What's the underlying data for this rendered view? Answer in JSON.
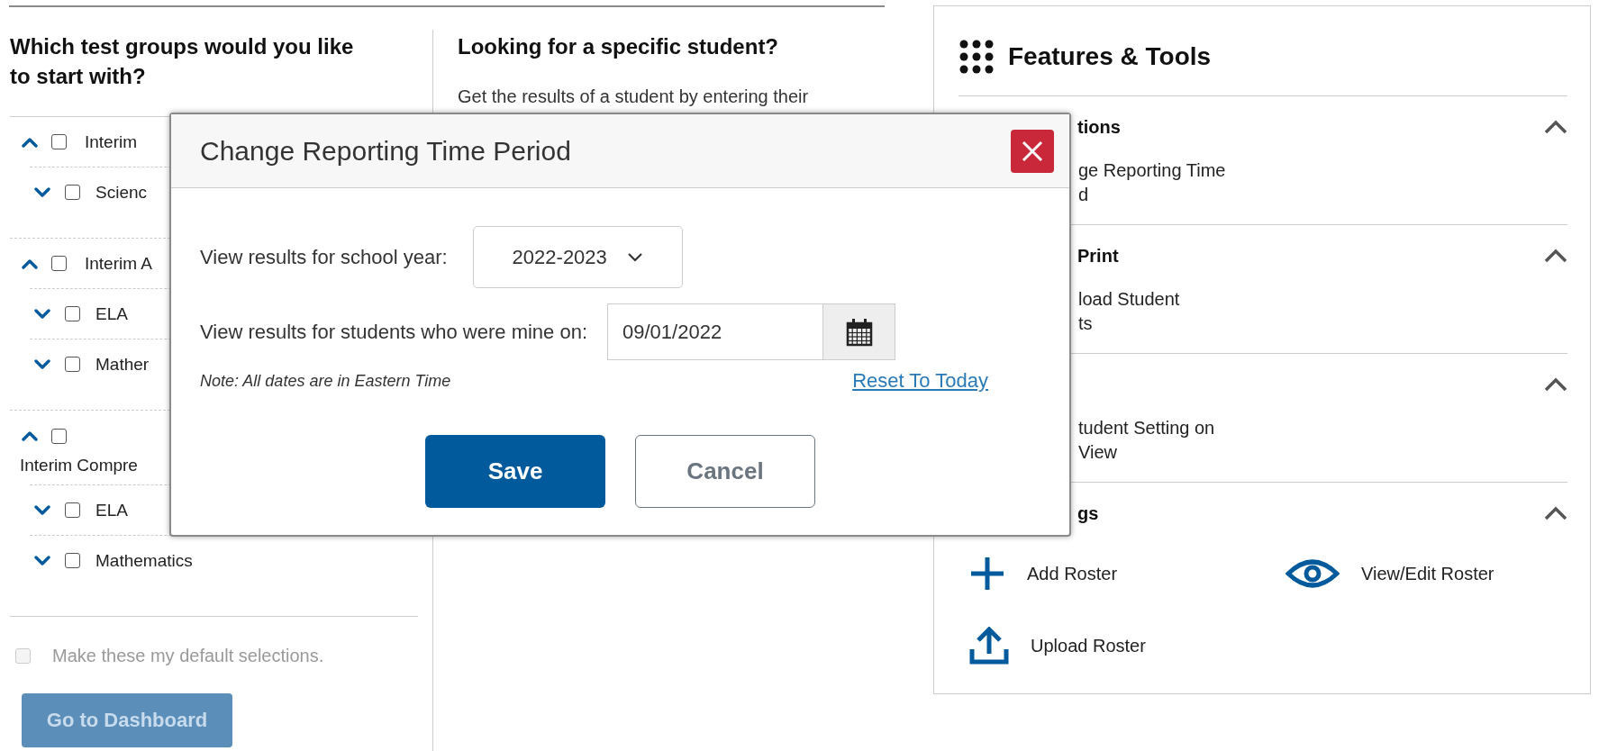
{
  "left": {
    "heading": "Which test groups would you like to start with?",
    "groups": [
      {
        "label": "Interim",
        "kind": "inline",
        "expanded": true,
        "checked": false,
        "children": [
          {
            "label": "Scienc",
            "expanded": false,
            "checked": false
          }
        ]
      },
      {
        "label": "Interim A",
        "kind": "inline",
        "expanded": true,
        "checked": false,
        "children": [
          {
            "label": "ELA",
            "expanded": false,
            "checked": false
          },
          {
            "label": "Mather",
            "expanded": false,
            "checked": false
          }
        ]
      },
      {
        "label": "Interim Compre",
        "kind": "stacked",
        "expanded": true,
        "checked": false,
        "children": [
          {
            "label": "ELA",
            "expanded": false,
            "checked": false
          },
          {
            "label": "Mathematics",
            "expanded": false,
            "checked": false
          }
        ]
      }
    ],
    "default_selection": {
      "label": "Make these my default selections.",
      "checked": false,
      "disabled": true
    },
    "dashboard_button": {
      "label": "Go to Dashboard",
      "disabled": true
    }
  },
  "middle": {
    "heading": "Looking for a specific student?",
    "text": "Get the results of a student by entering their"
  },
  "features": {
    "title": "Features & Tools",
    "sections": [
      {
        "title": "tions",
        "kind": "list",
        "expanded": true,
        "items": [
          {
            "label": "ge Reporting Time\nd"
          }
        ]
      },
      {
        "title": "Print",
        "kind": "list",
        "expanded": true,
        "items": [
          {
            "label": "load Student\nts"
          }
        ]
      },
      {
        "kind": "list",
        "expanded": true,
        "items": [
          {
            "label": "tudent Setting on\nView"
          }
        ]
      },
      {
        "title": "gs",
        "kind": "tiles",
        "expanded": true,
        "items": [
          {
            "label": "Add Roster",
            "kind": "add"
          },
          {
            "label": "View/Edit Roster",
            "kind": "view"
          },
          {
            "label": "Upload Roster",
            "kind": "upload"
          }
        ]
      }
    ]
  },
  "dialog": {
    "title": "Change Reporting Time Period",
    "school_year_label": "View results for school year:",
    "school_year": "2022-2023",
    "date_label": "View results for students who were mine on:",
    "date": "09/01/2022",
    "note": "Note: All dates are in Eastern Time",
    "reset_link": "Reset To Today",
    "buttons": [
      {
        "label": "Save",
        "kind": "primary"
      },
      {
        "label": "Cancel",
        "kind": "secondary"
      }
    ]
  }
}
